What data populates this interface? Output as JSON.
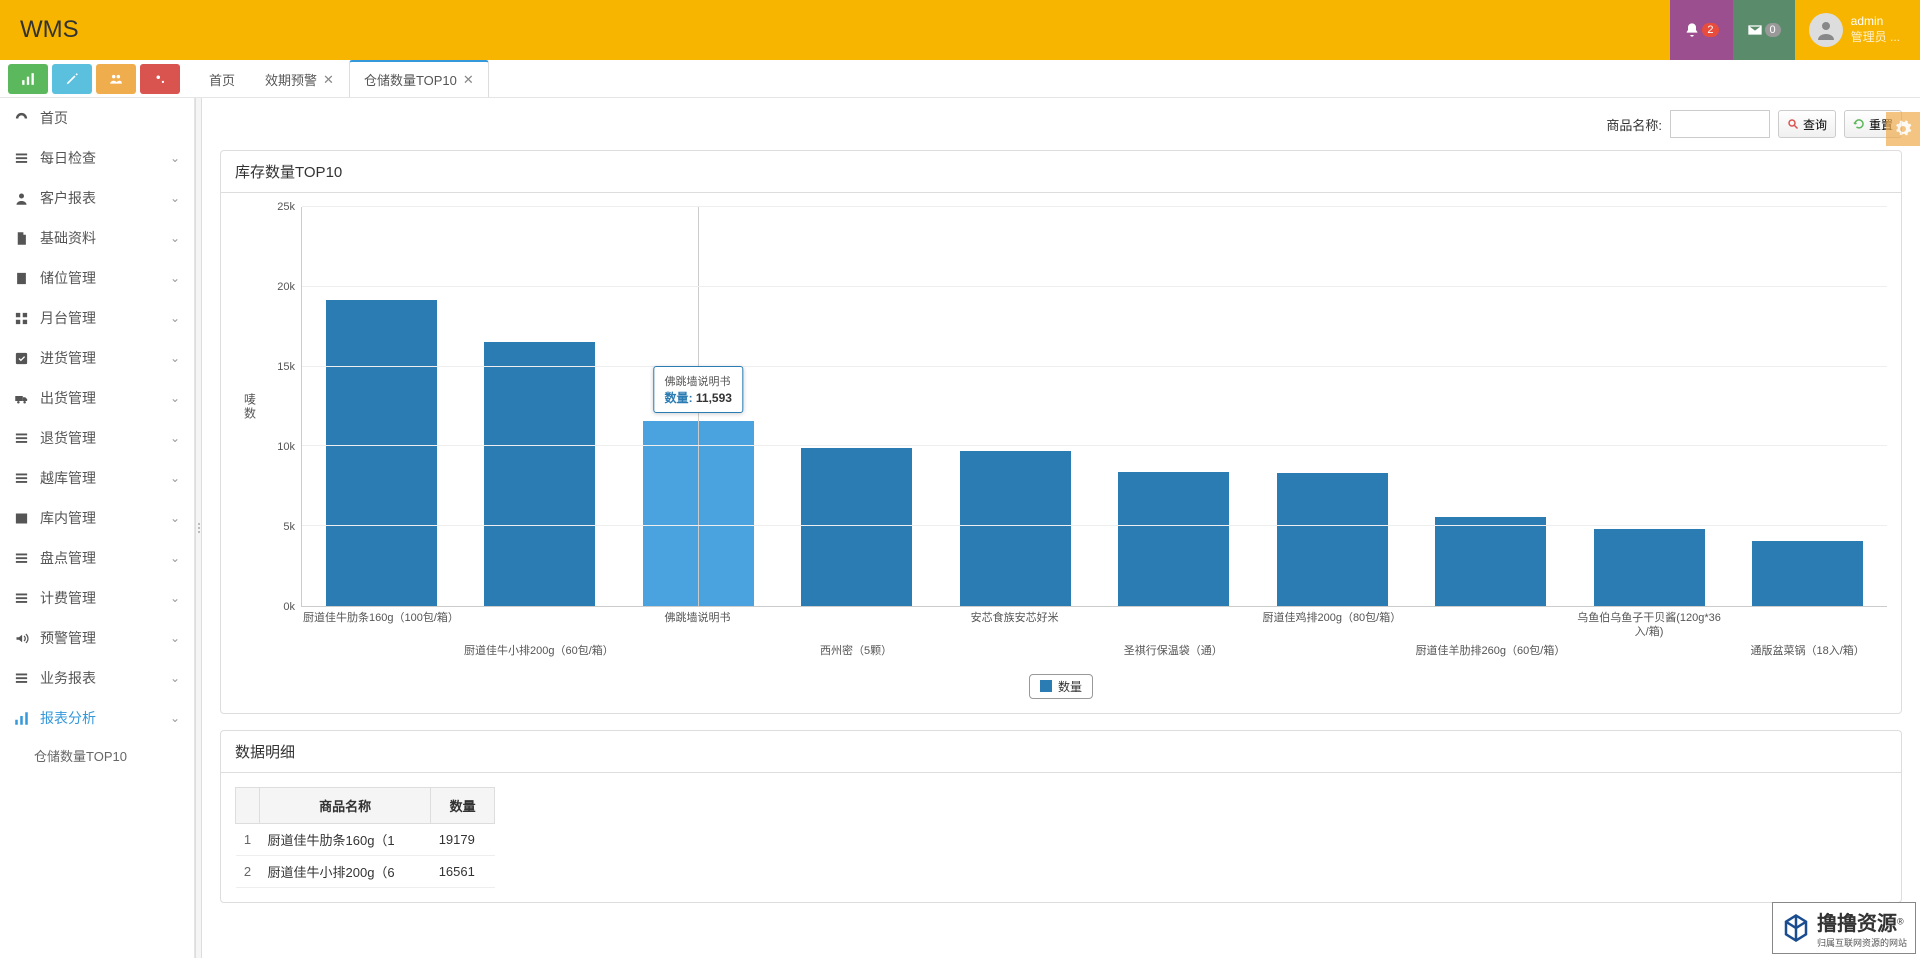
{
  "header": {
    "title": "WMS",
    "notif_count": "2",
    "mail_count": "0",
    "username": "admin",
    "role": "管理员 ..."
  },
  "tabs": [
    {
      "label": "首页",
      "closable": false,
      "active": false
    },
    {
      "label": "效期预警",
      "closable": true,
      "active": false
    },
    {
      "label": "仓储数量TOP10",
      "closable": true,
      "active": true
    }
  ],
  "sidebar": [
    {
      "icon": "dashboard",
      "label": "首页",
      "expandable": false
    },
    {
      "icon": "list",
      "label": "每日检查",
      "expandable": true
    },
    {
      "icon": "user",
      "label": "客户报表",
      "expandable": true
    },
    {
      "icon": "file",
      "label": "基础资料",
      "expandable": true
    },
    {
      "icon": "building",
      "label": "储位管理",
      "expandable": true
    },
    {
      "icon": "grid",
      "label": "月台管理",
      "expandable": true
    },
    {
      "icon": "check",
      "label": "进货管理",
      "expandable": true
    },
    {
      "icon": "truck",
      "label": "出货管理",
      "expandable": true
    },
    {
      "icon": "list",
      "label": "退货管理",
      "expandable": true
    },
    {
      "icon": "list",
      "label": "越库管理",
      "expandable": true
    },
    {
      "icon": "film",
      "label": "库内管理",
      "expandable": true
    },
    {
      "icon": "list",
      "label": "盘点管理",
      "expandable": true
    },
    {
      "icon": "list",
      "label": "计费管理",
      "expandable": true
    },
    {
      "icon": "volume",
      "label": "预警管理",
      "expandable": true
    },
    {
      "icon": "list",
      "label": "业务报表",
      "expandable": true
    },
    {
      "icon": "signal",
      "label": "报表分析",
      "expandable": true,
      "active": true,
      "sub": [
        {
          "label": "仓储数量TOP10"
        }
      ]
    }
  ],
  "filter": {
    "label": "商品名称:",
    "search_btn": "查询",
    "reset_btn": "重置"
  },
  "chart_panel_title": "库存数量TOP10",
  "chart_data": {
    "type": "bar",
    "ylabel": "唛数",
    "ylim": [
      0,
      25000
    ],
    "yticks": [
      "0k",
      "5k",
      "10k",
      "15k",
      "20k",
      "25k"
    ],
    "legend": "数量",
    "tooltip": {
      "title": "佛跳墙说明书",
      "label": "数量",
      "value": "11,593",
      "hover_index": 2
    },
    "categories": [
      "厨道佳牛肋条160g（100包/箱）",
      "厨道佳牛小排200g（60包/箱）",
      "佛跳墙说明书",
      "西州密（5颗）",
      "安芯食族安芯好米",
      "圣祺行保温袋（通）",
      "厨道佳鸡排200g（80包/箱）",
      "厨道佳羊肋排260g（60包/箱）",
      "乌鱼伯乌鱼子干贝酱(120g*36入/箱)",
      "通版盆菜锅（18入/箱）"
    ],
    "values": [
      19179,
      16561,
      11593,
      9900,
      9700,
      8400,
      8350,
      5600,
      4850,
      4100
    ]
  },
  "detail_panel_title": "数据明细",
  "detail_table": {
    "col_name": "商品名称",
    "col_qty": "数量",
    "rows": [
      {
        "idx": "1",
        "name": "厨道佳牛肋条160g（1",
        "qty": "19179"
      },
      {
        "idx": "2",
        "name": "厨道佳牛小排200g（6",
        "qty": "16561"
      }
    ]
  },
  "watermark": {
    "brand": "撸撸资源",
    "sub": "归属互联网资源的网站"
  }
}
